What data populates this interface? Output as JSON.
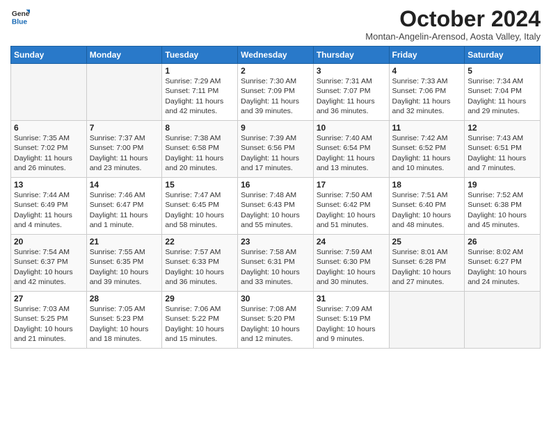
{
  "header": {
    "logo": {
      "line1": "General",
      "line2": "Blue"
    },
    "title": "October 2024",
    "subtitle": "Montan-Angelin-Arensod, Aosta Valley, Italy"
  },
  "weekdays": [
    "Sunday",
    "Monday",
    "Tuesday",
    "Wednesday",
    "Thursday",
    "Friday",
    "Saturday"
  ],
  "weeks": [
    [
      {
        "day": "",
        "info": ""
      },
      {
        "day": "",
        "info": ""
      },
      {
        "day": "1",
        "info": "Sunrise: 7:29 AM\nSunset: 7:11 PM\nDaylight: 11 hours and 42 minutes."
      },
      {
        "day": "2",
        "info": "Sunrise: 7:30 AM\nSunset: 7:09 PM\nDaylight: 11 hours and 39 minutes."
      },
      {
        "day": "3",
        "info": "Sunrise: 7:31 AM\nSunset: 7:07 PM\nDaylight: 11 hours and 36 minutes."
      },
      {
        "day": "4",
        "info": "Sunrise: 7:33 AM\nSunset: 7:06 PM\nDaylight: 11 hours and 32 minutes."
      },
      {
        "day": "5",
        "info": "Sunrise: 7:34 AM\nSunset: 7:04 PM\nDaylight: 11 hours and 29 minutes."
      }
    ],
    [
      {
        "day": "6",
        "info": "Sunrise: 7:35 AM\nSunset: 7:02 PM\nDaylight: 11 hours and 26 minutes."
      },
      {
        "day": "7",
        "info": "Sunrise: 7:37 AM\nSunset: 7:00 PM\nDaylight: 11 hours and 23 minutes."
      },
      {
        "day": "8",
        "info": "Sunrise: 7:38 AM\nSunset: 6:58 PM\nDaylight: 11 hours and 20 minutes."
      },
      {
        "day": "9",
        "info": "Sunrise: 7:39 AM\nSunset: 6:56 PM\nDaylight: 11 hours and 17 minutes."
      },
      {
        "day": "10",
        "info": "Sunrise: 7:40 AM\nSunset: 6:54 PM\nDaylight: 11 hours and 13 minutes."
      },
      {
        "day": "11",
        "info": "Sunrise: 7:42 AM\nSunset: 6:52 PM\nDaylight: 11 hours and 10 minutes."
      },
      {
        "day": "12",
        "info": "Sunrise: 7:43 AM\nSunset: 6:51 PM\nDaylight: 11 hours and 7 minutes."
      }
    ],
    [
      {
        "day": "13",
        "info": "Sunrise: 7:44 AM\nSunset: 6:49 PM\nDaylight: 11 hours and 4 minutes."
      },
      {
        "day": "14",
        "info": "Sunrise: 7:46 AM\nSunset: 6:47 PM\nDaylight: 11 hours and 1 minute."
      },
      {
        "day": "15",
        "info": "Sunrise: 7:47 AM\nSunset: 6:45 PM\nDaylight: 10 hours and 58 minutes."
      },
      {
        "day": "16",
        "info": "Sunrise: 7:48 AM\nSunset: 6:43 PM\nDaylight: 10 hours and 55 minutes."
      },
      {
        "day": "17",
        "info": "Sunrise: 7:50 AM\nSunset: 6:42 PM\nDaylight: 10 hours and 51 minutes."
      },
      {
        "day": "18",
        "info": "Sunrise: 7:51 AM\nSunset: 6:40 PM\nDaylight: 10 hours and 48 minutes."
      },
      {
        "day": "19",
        "info": "Sunrise: 7:52 AM\nSunset: 6:38 PM\nDaylight: 10 hours and 45 minutes."
      }
    ],
    [
      {
        "day": "20",
        "info": "Sunrise: 7:54 AM\nSunset: 6:37 PM\nDaylight: 10 hours and 42 minutes."
      },
      {
        "day": "21",
        "info": "Sunrise: 7:55 AM\nSunset: 6:35 PM\nDaylight: 10 hours and 39 minutes."
      },
      {
        "day": "22",
        "info": "Sunrise: 7:57 AM\nSunset: 6:33 PM\nDaylight: 10 hours and 36 minutes."
      },
      {
        "day": "23",
        "info": "Sunrise: 7:58 AM\nSunset: 6:31 PM\nDaylight: 10 hours and 33 minutes."
      },
      {
        "day": "24",
        "info": "Sunrise: 7:59 AM\nSunset: 6:30 PM\nDaylight: 10 hours and 30 minutes."
      },
      {
        "day": "25",
        "info": "Sunrise: 8:01 AM\nSunset: 6:28 PM\nDaylight: 10 hours and 27 minutes."
      },
      {
        "day": "26",
        "info": "Sunrise: 8:02 AM\nSunset: 6:27 PM\nDaylight: 10 hours and 24 minutes."
      }
    ],
    [
      {
        "day": "27",
        "info": "Sunrise: 7:03 AM\nSunset: 5:25 PM\nDaylight: 10 hours and 21 minutes."
      },
      {
        "day": "28",
        "info": "Sunrise: 7:05 AM\nSunset: 5:23 PM\nDaylight: 10 hours and 18 minutes."
      },
      {
        "day": "29",
        "info": "Sunrise: 7:06 AM\nSunset: 5:22 PM\nDaylight: 10 hours and 15 minutes."
      },
      {
        "day": "30",
        "info": "Sunrise: 7:08 AM\nSunset: 5:20 PM\nDaylight: 10 hours and 12 minutes."
      },
      {
        "day": "31",
        "info": "Sunrise: 7:09 AM\nSunset: 5:19 PM\nDaylight: 10 hours and 9 minutes."
      },
      {
        "day": "",
        "info": ""
      },
      {
        "day": "",
        "info": ""
      }
    ]
  ]
}
